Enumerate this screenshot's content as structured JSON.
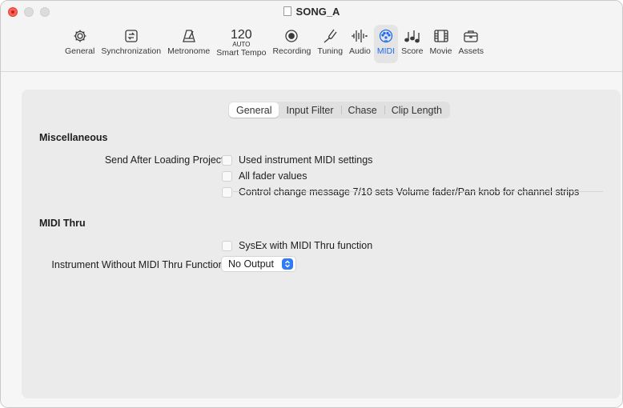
{
  "window": {
    "title": "SONG_A"
  },
  "toolbar": {
    "items": [
      {
        "label": "General",
        "icon": "gear-icon"
      },
      {
        "label": "Synchronization",
        "icon": "sync-icon"
      },
      {
        "label": "Metronome",
        "icon": "metronome-icon"
      },
      {
        "label": "Smart Tempo",
        "icon": "tempo-icon",
        "big": "120",
        "small": "AUTO"
      },
      {
        "label": "Recording",
        "icon": "record-icon"
      },
      {
        "label": "Tuning",
        "icon": "tuning-fork-icon"
      },
      {
        "label": "Audio",
        "icon": "waveform-icon"
      },
      {
        "label": "MIDI",
        "icon": "midi-connector-icon",
        "active": true
      },
      {
        "label": "Score",
        "icon": "music-notes-icon"
      },
      {
        "label": "Movie",
        "icon": "film-icon"
      },
      {
        "label": "Assets",
        "icon": "briefcase-icon"
      }
    ]
  },
  "tabs": {
    "items": [
      "General",
      "Input Filter",
      "Chase",
      "Clip Length"
    ],
    "selected": "General"
  },
  "misc": {
    "heading": "Miscellaneous",
    "send_label": "Send After Loading Project:",
    "options": [
      {
        "label": "Used instrument MIDI settings",
        "checked": false
      },
      {
        "label": "All fader values",
        "checked": false
      },
      {
        "label": "Control change message 7/10 sets Volume fader/Pan knob for channel strips",
        "checked": false
      }
    ]
  },
  "thru": {
    "heading": "MIDI Thru",
    "sysex_label": "SysEx with MIDI Thru function",
    "sysex_checked": false,
    "instrument_label": "Instrument Without MIDI Thru Function:",
    "instrument_value": "No Output"
  },
  "colors": {
    "accent": "#1d6cf0",
    "close": "#ff5f57"
  }
}
